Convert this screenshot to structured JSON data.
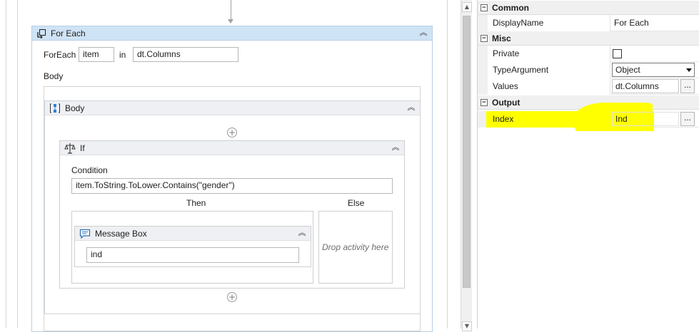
{
  "foreach": {
    "title": "For Each",
    "foreach_label": "ForEach",
    "item_value": "item",
    "in_label": "in",
    "collection_value": "dt.Columns",
    "body_label": "Body"
  },
  "body_sequence": {
    "title": "Body"
  },
  "if_activity": {
    "title": "If",
    "condition_label": "Condition",
    "condition_value": "item.ToString.ToLower.Contains(\"gender\")",
    "then_label": "Then",
    "else_label": "Else",
    "else_placeholder": "Drop activity here"
  },
  "message_box": {
    "title": "Message Box",
    "text_value": "ind"
  },
  "properties": {
    "categories": {
      "common": "Common",
      "misc": "Misc",
      "output": "Output"
    },
    "toggle_symbol": "⊟",
    "rows": {
      "display_name": {
        "name": "DisplayName",
        "value": "For Each"
      },
      "private": {
        "name": "Private",
        "checked": false
      },
      "type_argument": {
        "name": "TypeArgument",
        "value": "Object"
      },
      "values": {
        "name": "Values",
        "value": "dt.Columns"
      },
      "index": {
        "name": "Index",
        "value": "Ind"
      }
    },
    "ellipsis": "...",
    "highlight_color": "#ffff00"
  },
  "icons": {
    "collapse": "double-chevron-up",
    "add": "plus-circle"
  }
}
